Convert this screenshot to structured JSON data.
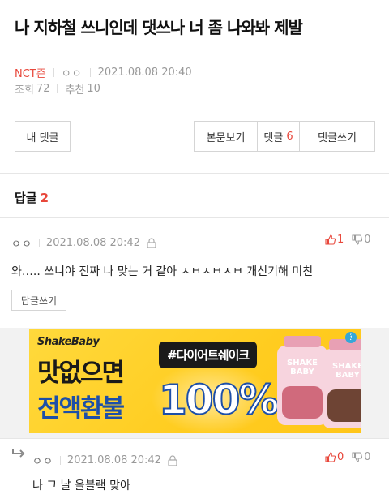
{
  "post": {
    "title": "나 지하철 쓰니인데 댓쓰나 너 좀 나와봐 제발",
    "category": "NCT즌",
    "author": "ㅇㅇ",
    "date": "2021.08.08 20:40",
    "views_label": "조회",
    "views": "72",
    "likes_label": "추천",
    "likes": "10"
  },
  "actions": {
    "my_comments": "내 댓글",
    "view_post": "본문보기",
    "comments_label": "댓글",
    "comments_count": "6",
    "write_comment": "댓글쓰기"
  },
  "replies": {
    "label": "답글",
    "count": "2"
  },
  "comments": [
    {
      "author": "ㅇㅇ",
      "date": "2021.08.08 20:42",
      "up": "1",
      "down": "0",
      "text": "와….. 쓰니야 진짜 나 맞는 거 같아 ㅅㅂㅅㅂㅅㅂ 개신기해 미친",
      "reply_button": "답글쓰기"
    },
    {
      "author": "ㅇㅇ",
      "date": "2021.08.08 20:42",
      "up": "0",
      "down": "0",
      "text": "나 그 날 올블랙 맞아"
    }
  ],
  "ad": {
    "brand": "ShakeBaby",
    "line1": "맛없으면",
    "line2": "전액환불",
    "tag": "#다이어트쉐이크",
    "percent": "100%",
    "bottle_label": "SHAKE BABY"
  },
  "colors": {
    "accent": "#e8473b",
    "ad_bg": "#ffcc1f",
    "ad_blue": "#1d4fa8"
  }
}
